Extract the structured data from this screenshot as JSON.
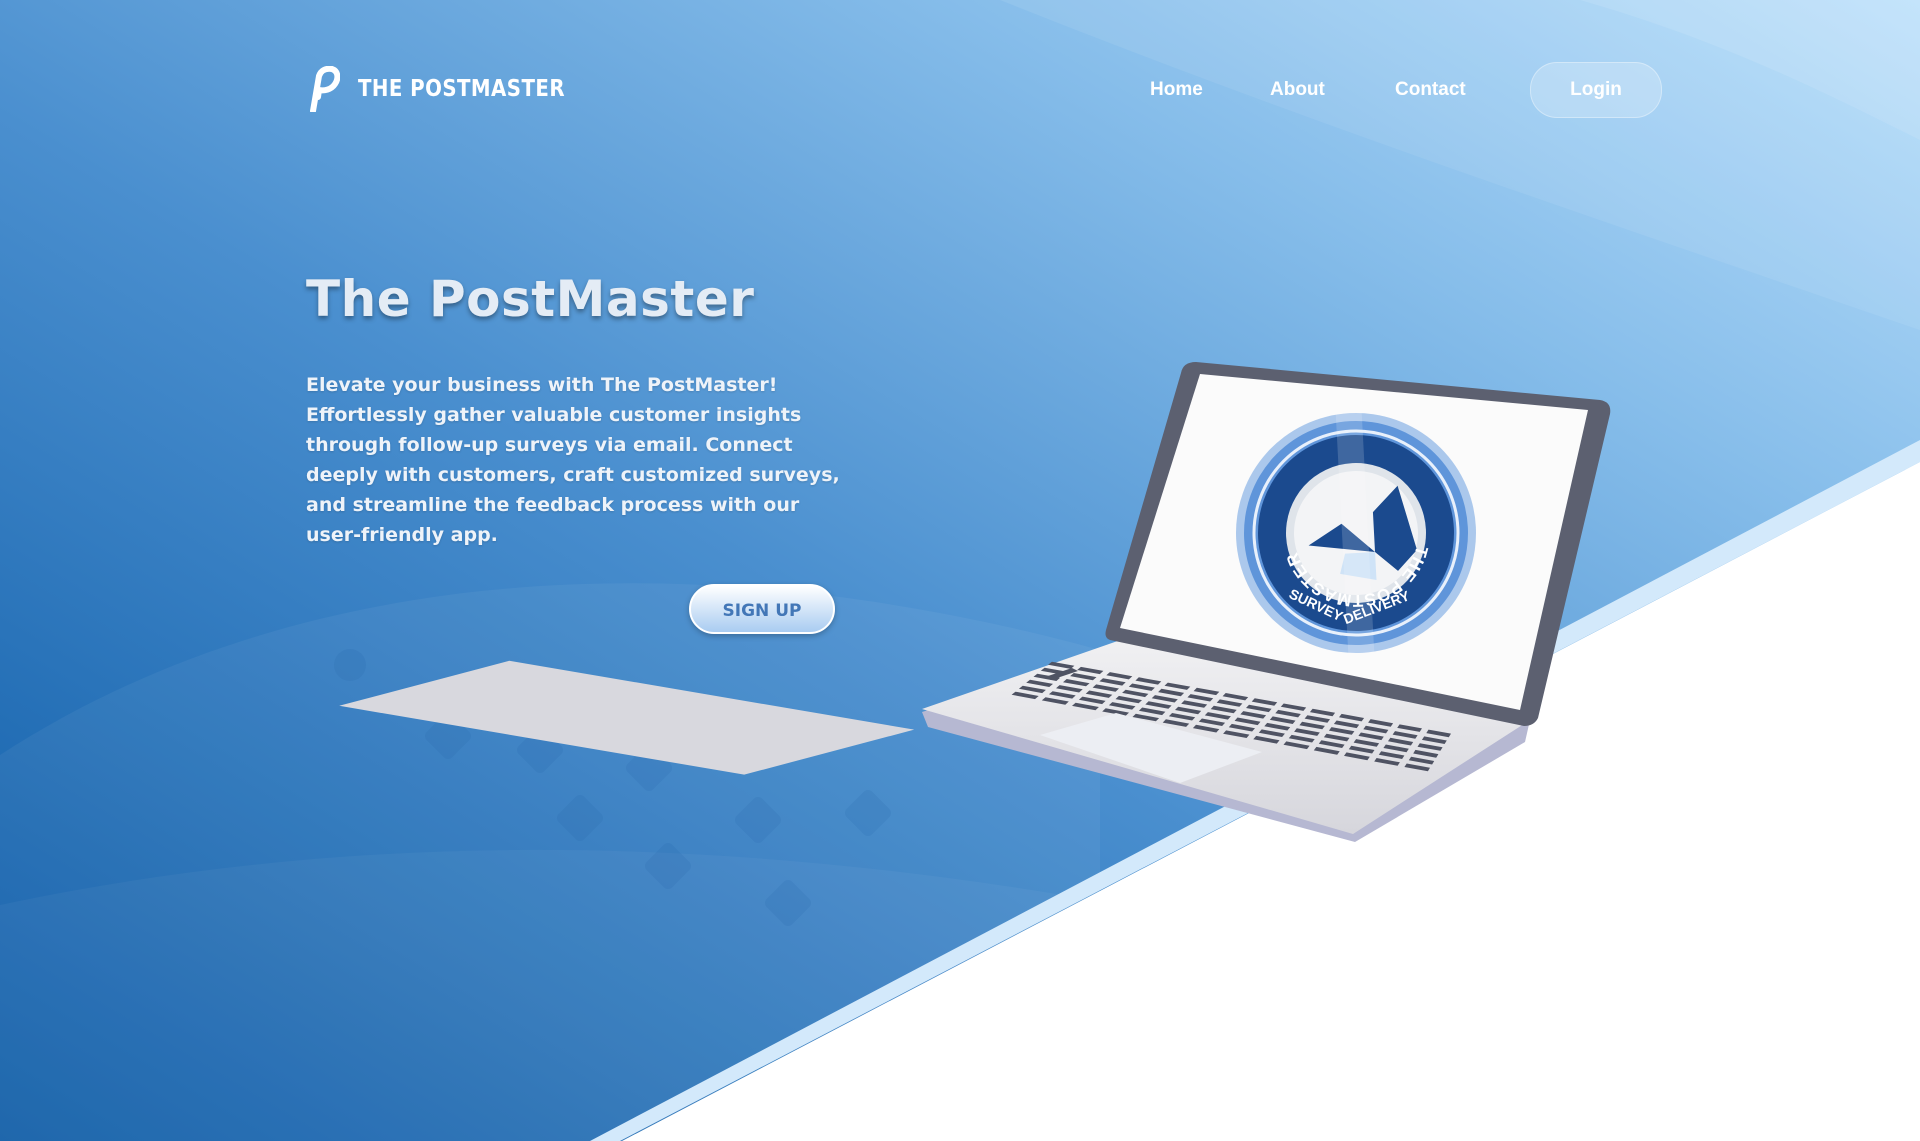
{
  "brand": {
    "name": "THE POSTMASTER",
    "icon": "stylized-p-logo-icon"
  },
  "nav": {
    "items": [
      {
        "label": "Home"
      },
      {
        "label": "About"
      },
      {
        "label": "Contact"
      }
    ],
    "login_label": "Login"
  },
  "hero": {
    "title": "The PostMaster",
    "description": "Elevate your business with The PostMaster! Effortlessly gather valuable customer insights through follow-up surveys via email. Connect deeply with customers, craft customized surveys, and streamline the feedback process with our user-friendly app.",
    "cta_label": "SIGN UP"
  },
  "illustration": {
    "badge_top_text": "THE POSTMASTER",
    "badge_bottom_left": "SURVEY",
    "badge_bottom_right": "DELIVERY"
  },
  "colors": {
    "primary_blue": "#0a5aa6",
    "light_blue": "#b9dcfa",
    "badge_navy": "#1a4a8c",
    "white": "#ffffff"
  }
}
